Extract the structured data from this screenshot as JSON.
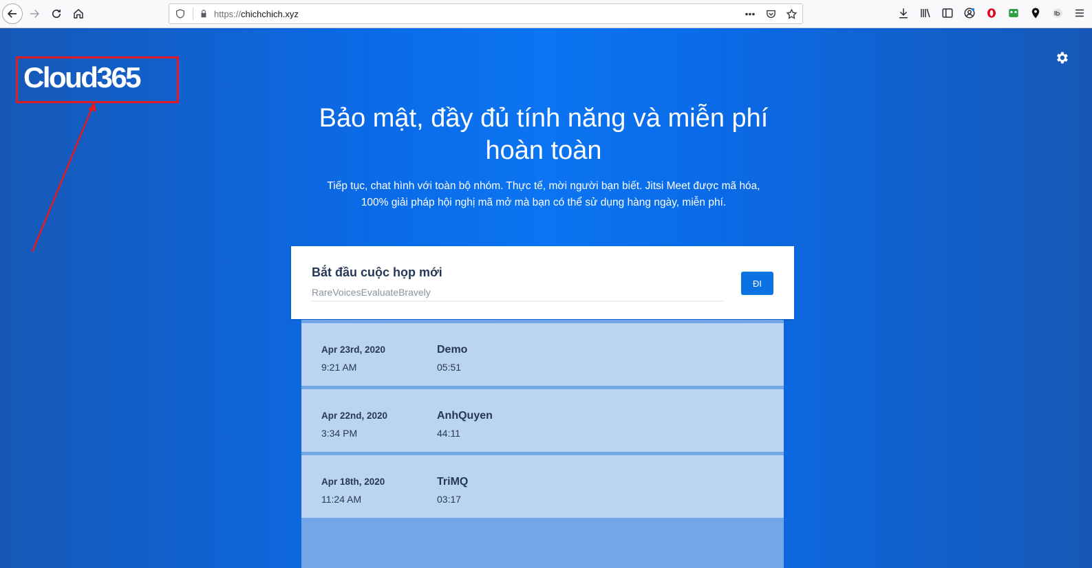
{
  "browser": {
    "url_scheme": "https://",
    "url_host": "chichchich.xyz",
    "page_actions_label": "•••"
  },
  "page": {
    "logo": "Cloud365",
    "headline": "Bảo mật, đầy đủ tính năng và miễn phí hoàn toàn",
    "subtext": "Tiếp tục, chat hình với toàn bộ nhóm. Thực tế, mời người bạn biết. Jitsi Meet được mã hóa, 100% giải pháp hội nghị mã mở mà bạn có thể sử dụng hàng ngày, miễn phí."
  },
  "start_meeting": {
    "title": "Bắt đầu cuộc họp mới",
    "room_placeholder": "RareVoicesEvaluateBravely",
    "go_label": "ĐI"
  },
  "recent_meetings": [
    {
      "date": "Apr 23rd, 2020",
      "time": "9:21 AM",
      "room": "Demo",
      "duration": "05:51"
    },
    {
      "date": "Apr 22nd, 2020",
      "time": "3:34 PM",
      "room": "AnhQuyen",
      "duration": "44:11"
    },
    {
      "date": "Apr 18th, 2020",
      "time": "11:24 AM",
      "room": "TriMQ",
      "duration": "03:17"
    }
  ],
  "colors": {
    "accent": "#0b72e2",
    "annotation": "#e31b23",
    "recent_item_bg": "#bbd4f1"
  }
}
